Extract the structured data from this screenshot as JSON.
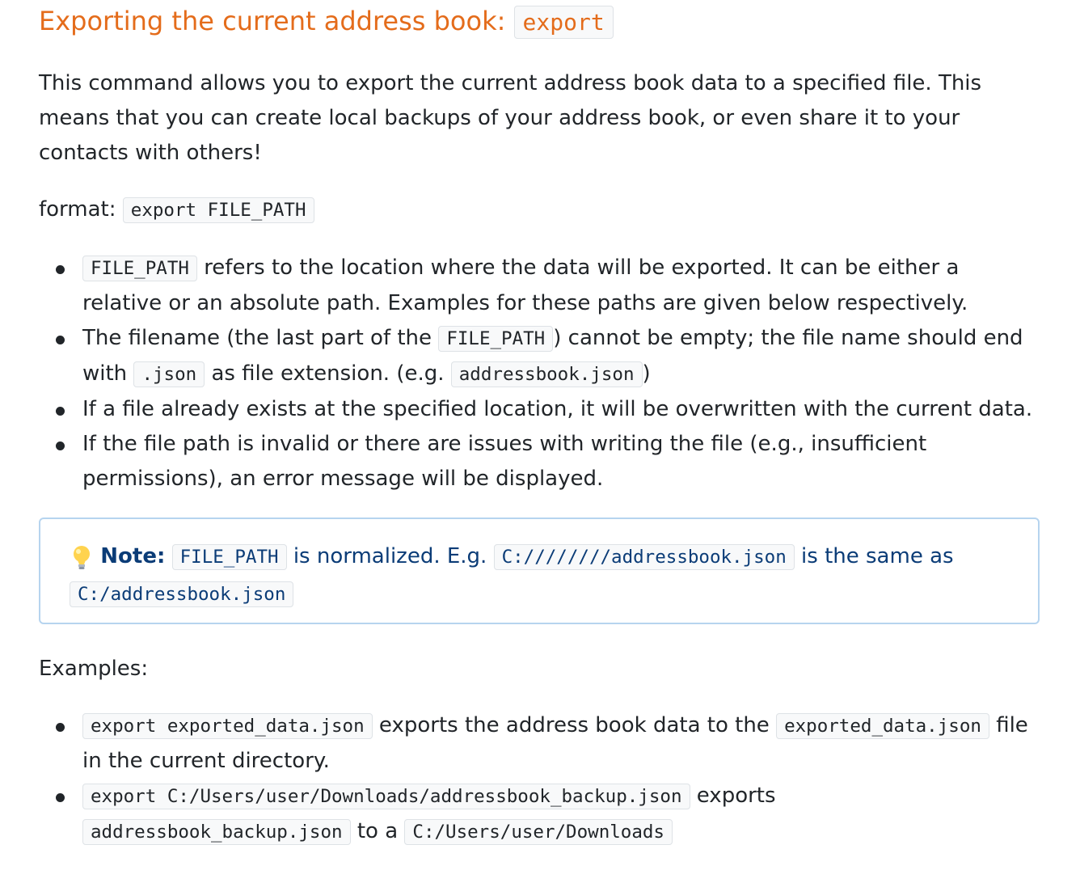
{
  "heading": {
    "text": "Exporting the current address book:",
    "code": "export"
  },
  "intro": "This command allows you to export the current address book data to a specified file. This means that you can create local backups of your address book, or even share it to your contacts with others!",
  "format": {
    "label": "format:",
    "code": "export FILE_PATH"
  },
  "params": [
    {
      "code": "FILE_PATH",
      "text": "refers to the location where the data will be exported. It can be either a relative or an absolute path. Examples for these paths are given below respectively."
    },
    {
      "t1": "The filename (the last part of the",
      "c1": "FILE_PATH",
      "t2": ") cannot be empty; the file name should end with",
      "c2": ".json",
      "t3": "as file extension. (e.g.",
      "c3": "addressbook.json",
      "t4": ")"
    },
    {
      "text": "If a file already exists at the specified location, it will be overwritten with the current data."
    },
    {
      "text": "If the file path is invalid or there are issues with writing the file (e.g., insufficient permissions), an error message will be displayed."
    }
  ],
  "note": {
    "icon": "lightbulb-icon",
    "label": "Note:",
    "c1": "FILE_PATH",
    "t1": "is normalized. E.g.",
    "c2": "C:////////addressbook.json",
    "t2": "is the same as",
    "c3": "C:/addressbook.json"
  },
  "examples_label": "Examples:",
  "examples": [
    {
      "c1": "export exported_data.json",
      "t1": "exports the address book data to the",
      "c2": "exported_data.json",
      "t2": "file in the current directory."
    },
    {
      "c1": "export C:/Users/user/Downloads/addressbook_backup.json",
      "t1": "exports",
      "c2": "addressbook_backup.json",
      "t2": "to a",
      "c3": "C:/Users/user/Downloads"
    }
  ],
  "colors": {
    "heading": "#e46c1b",
    "note_text": "#0b3c77",
    "note_border": "#b6d4ef",
    "code_bg": "#f8f9fa"
  }
}
